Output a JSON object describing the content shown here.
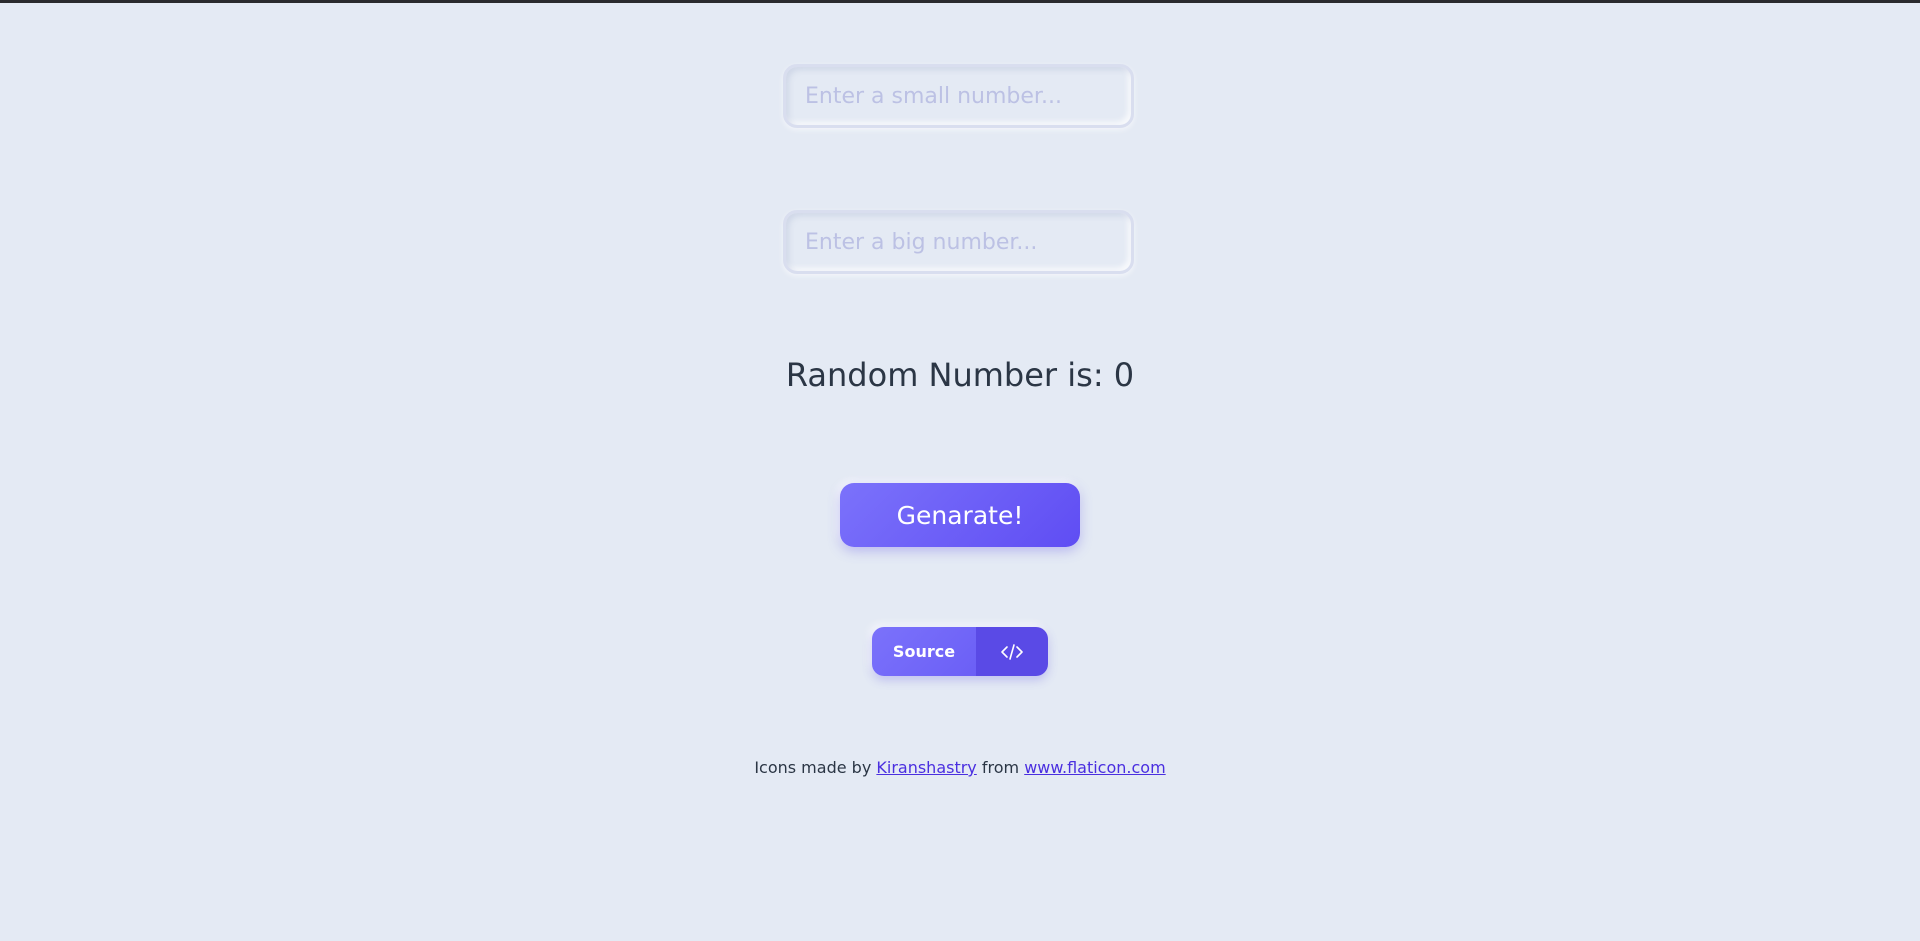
{
  "inputs": {
    "small_placeholder": "Enter a small number...",
    "small_value": "",
    "big_placeholder": "Enter a big number...",
    "big_value": ""
  },
  "result": {
    "label": "Random Number is: 0"
  },
  "generate_button": {
    "label": "Genarate!"
  },
  "source_button": {
    "label": "Source",
    "icon": "code-icon"
  },
  "credits": {
    "prefix": "Icons made by",
    "author": "Kiranshastry",
    "middle": "from",
    "site": "www.flaticon.com"
  },
  "colors": {
    "background": "#e4eaf4",
    "accent": "#6c5ff7",
    "accent_dark": "#5a4ae6",
    "text": "#2b3645",
    "placeholder": "#bcc1e4",
    "link": "#4a2fe0"
  }
}
